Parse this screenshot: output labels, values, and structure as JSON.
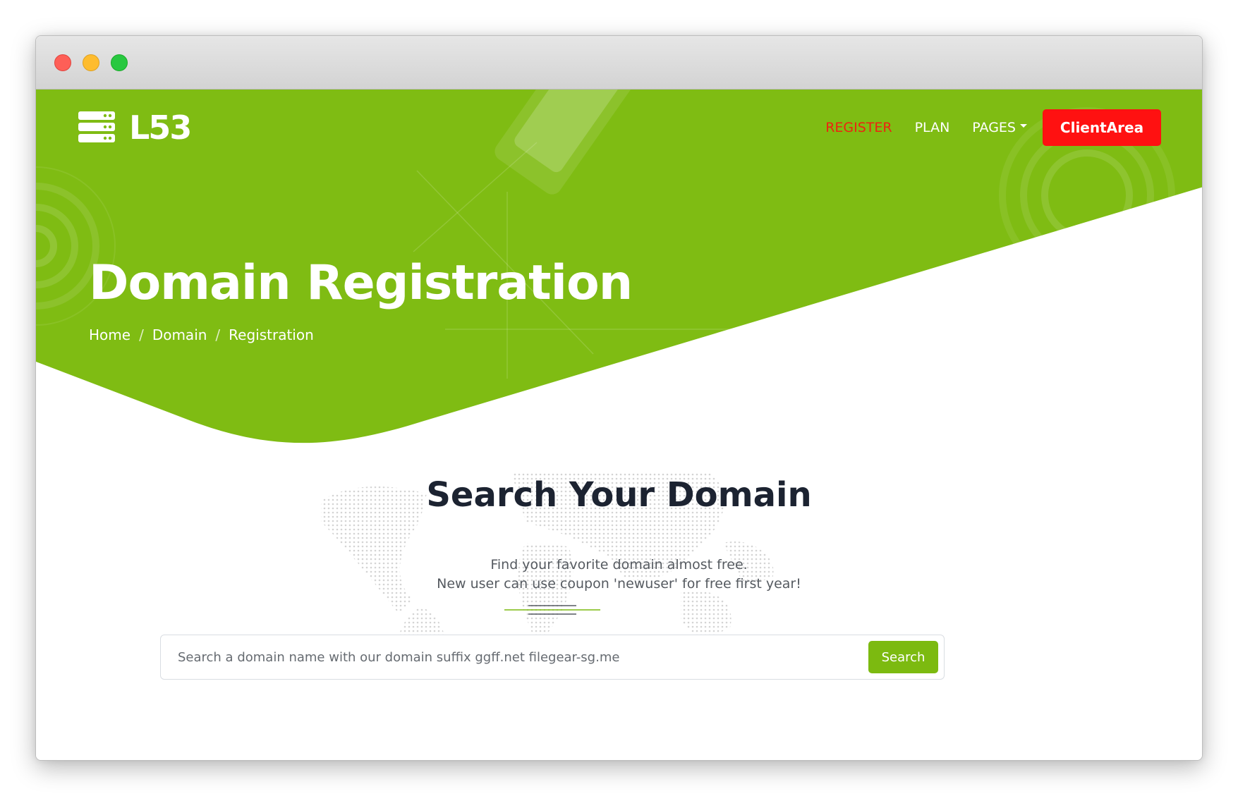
{
  "brand": {
    "name": "L53",
    "icon": "server-stack-icon",
    "accent_color": "#7fbc13",
    "cta_color": "#ff1111"
  },
  "nav": {
    "items": [
      {
        "label": "REGISTER",
        "active": true
      },
      {
        "label": "PLAN",
        "active": false
      },
      {
        "label": "PAGES",
        "dropdown": true
      }
    ],
    "cta_label": "ClientArea"
  },
  "hero": {
    "title": "Domain Registration",
    "breadcrumb": [
      "Home",
      "Domain",
      "Registration"
    ],
    "separator": "/"
  },
  "search_section": {
    "title": "Search Your Domain",
    "subtitle_line1": "Find your favorite domain almost free.",
    "subtitle_line2": "New user can use coupon 'newuser' for free first year!",
    "input_placeholder": "Search a domain name with our domain suffix ggff.net filegear-sg.me",
    "button_label": "Search"
  }
}
